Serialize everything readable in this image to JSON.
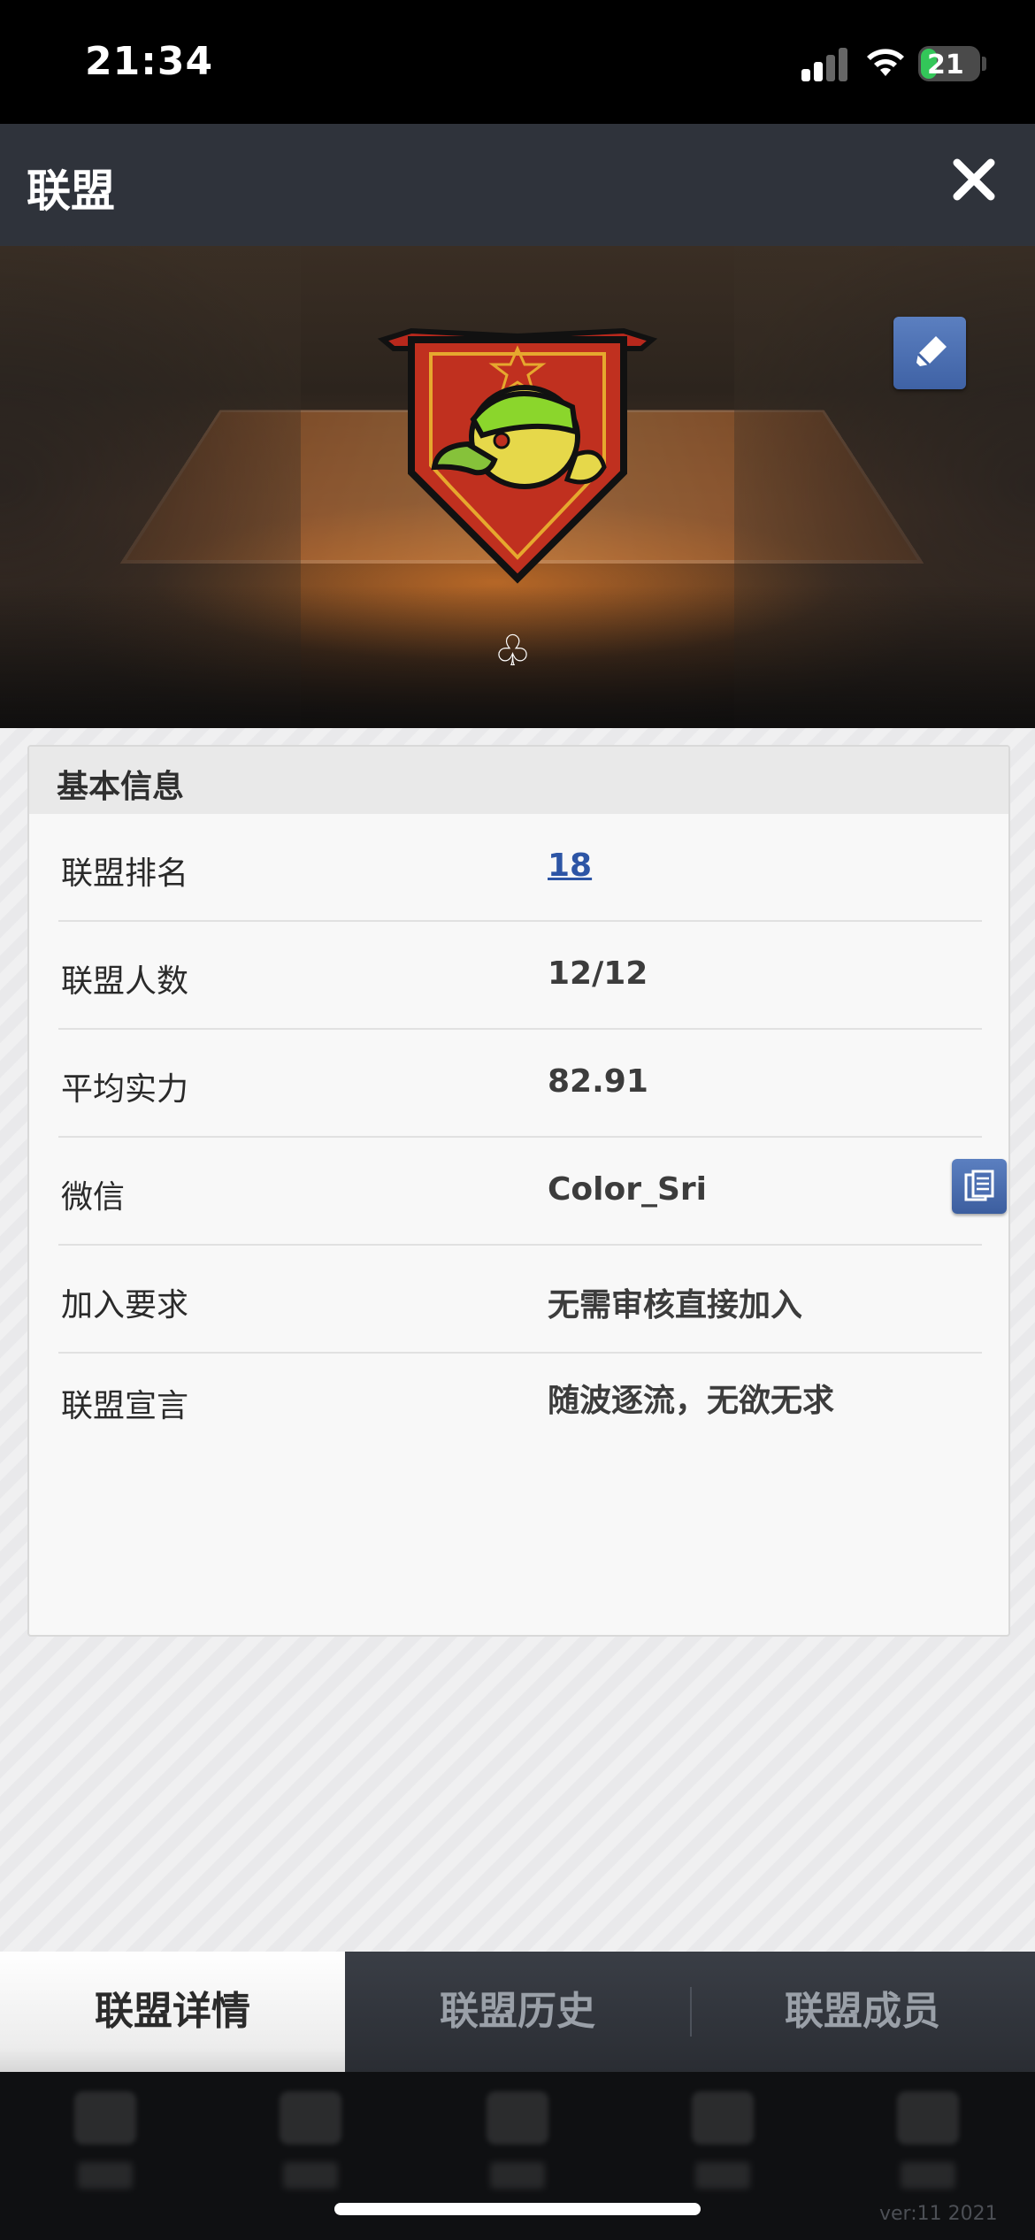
{
  "status_bar": {
    "time": "21:34",
    "battery": "21"
  },
  "header": {
    "title": "联盟"
  },
  "basic_info": {
    "title": "基本信息",
    "rows": [
      {
        "label": "联盟排名",
        "value": "18"
      },
      {
        "label": "联盟人数",
        "value": "12/12"
      },
      {
        "label": "平均实力",
        "value": "82.91"
      },
      {
        "label": "微信",
        "value": "Color_Sri"
      },
      {
        "label": "加入要求",
        "value": "无需审核直接加入"
      },
      {
        "label": "联盟宣言",
        "value": "随波逐流，无欲无求"
      }
    ]
  },
  "tabs": [
    {
      "label": "联盟详情",
      "active": true
    },
    {
      "label": "联盟历史",
      "active": false
    },
    {
      "label": "联盟成员",
      "active": false
    }
  ],
  "footer": {
    "version": "ver:11  2021"
  },
  "colors": {
    "accent_blue": "#4a6fb5",
    "link_blue": "#2d55a5",
    "header_bg": "#2f333b"
  }
}
